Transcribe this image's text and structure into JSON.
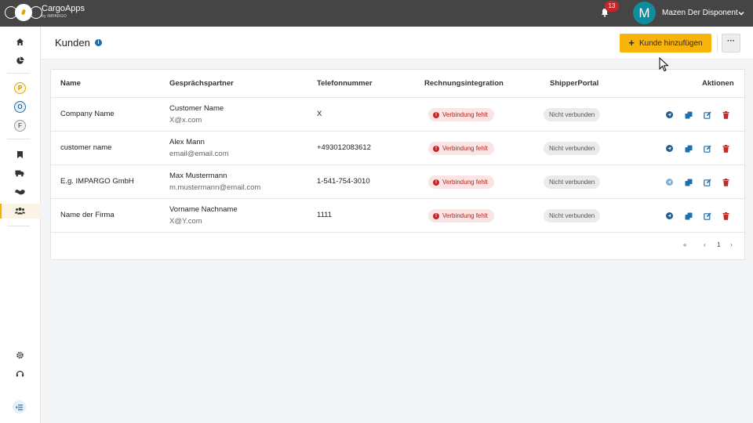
{
  "app": {
    "brand_name": "CargoApps",
    "brand_sub": "by IMPARGO",
    "notifications_count": "13",
    "user_initial": "M",
    "user_name": "Mazen Der Disponent",
    "accent_color": "#f8b40b",
    "topbar_color": "#454545"
  },
  "sidebar": {
    "items": [
      {
        "icon": "home-icon"
      },
      {
        "icon": "pie-chart-icon"
      },
      {
        "letter": "P",
        "color": "#e0a800"
      },
      {
        "letter": "O",
        "color": "#1f6fad"
      },
      {
        "letter": "F",
        "color": "#888888"
      },
      {
        "icon": "bookmark-icon"
      },
      {
        "icon": "truck-icon"
      },
      {
        "icon": "handshake-icon"
      },
      {
        "icon": "users-icon",
        "active": true
      },
      {
        "icon": "gear-icon"
      },
      {
        "icon": "support-icon"
      },
      {
        "icon": "collapse-menu-icon"
      }
    ]
  },
  "page": {
    "title": "Kunden",
    "add_button": "Kunde hinzufügen",
    "more_button": "···"
  },
  "table": {
    "columns": {
      "name": "Name",
      "contact": "Gesprächspartner",
      "phone": "Telefonnummer",
      "invoice": "Rechnungsintegration",
      "portal": "ShipperPortal",
      "actions": "Aktionen"
    },
    "rows": [
      {
        "name": "Company Name",
        "contact_name": "Customer Name",
        "contact_email": "X@x.com",
        "phone": "X",
        "invoice_status": "Verbindung fehlt",
        "portal_status": "Nicht verbunden"
      },
      {
        "name": "customer name",
        "contact_name": "Alex Mann",
        "contact_email": "email@email.com",
        "phone": "+493012083612",
        "invoice_status": "Verbindung fehlt",
        "portal_status": "Nicht verbunden"
      },
      {
        "name": "E.g. IMPARGO GmbH",
        "contact_name": "Max Mustermann",
        "contact_email": "m.mustermann@email.com",
        "phone": "1-541-754-3010",
        "invoice_status": "Verbindung fehlt",
        "portal_status": "Nicht verbunden"
      },
      {
        "name": "Name der Firma",
        "contact_name": "Vorname Nachname",
        "contact_email": "X@Y.com",
        "phone": "1111",
        "invoice_status": "Verbindung fehlt",
        "portal_status": "Nicht verbunden"
      }
    ],
    "row_actions": [
      "send-icon",
      "copy-icon",
      "edit-icon",
      "delete-icon"
    ]
  },
  "pagination": {
    "first": "«",
    "prev": "‹",
    "page": "1",
    "next": "›"
  }
}
